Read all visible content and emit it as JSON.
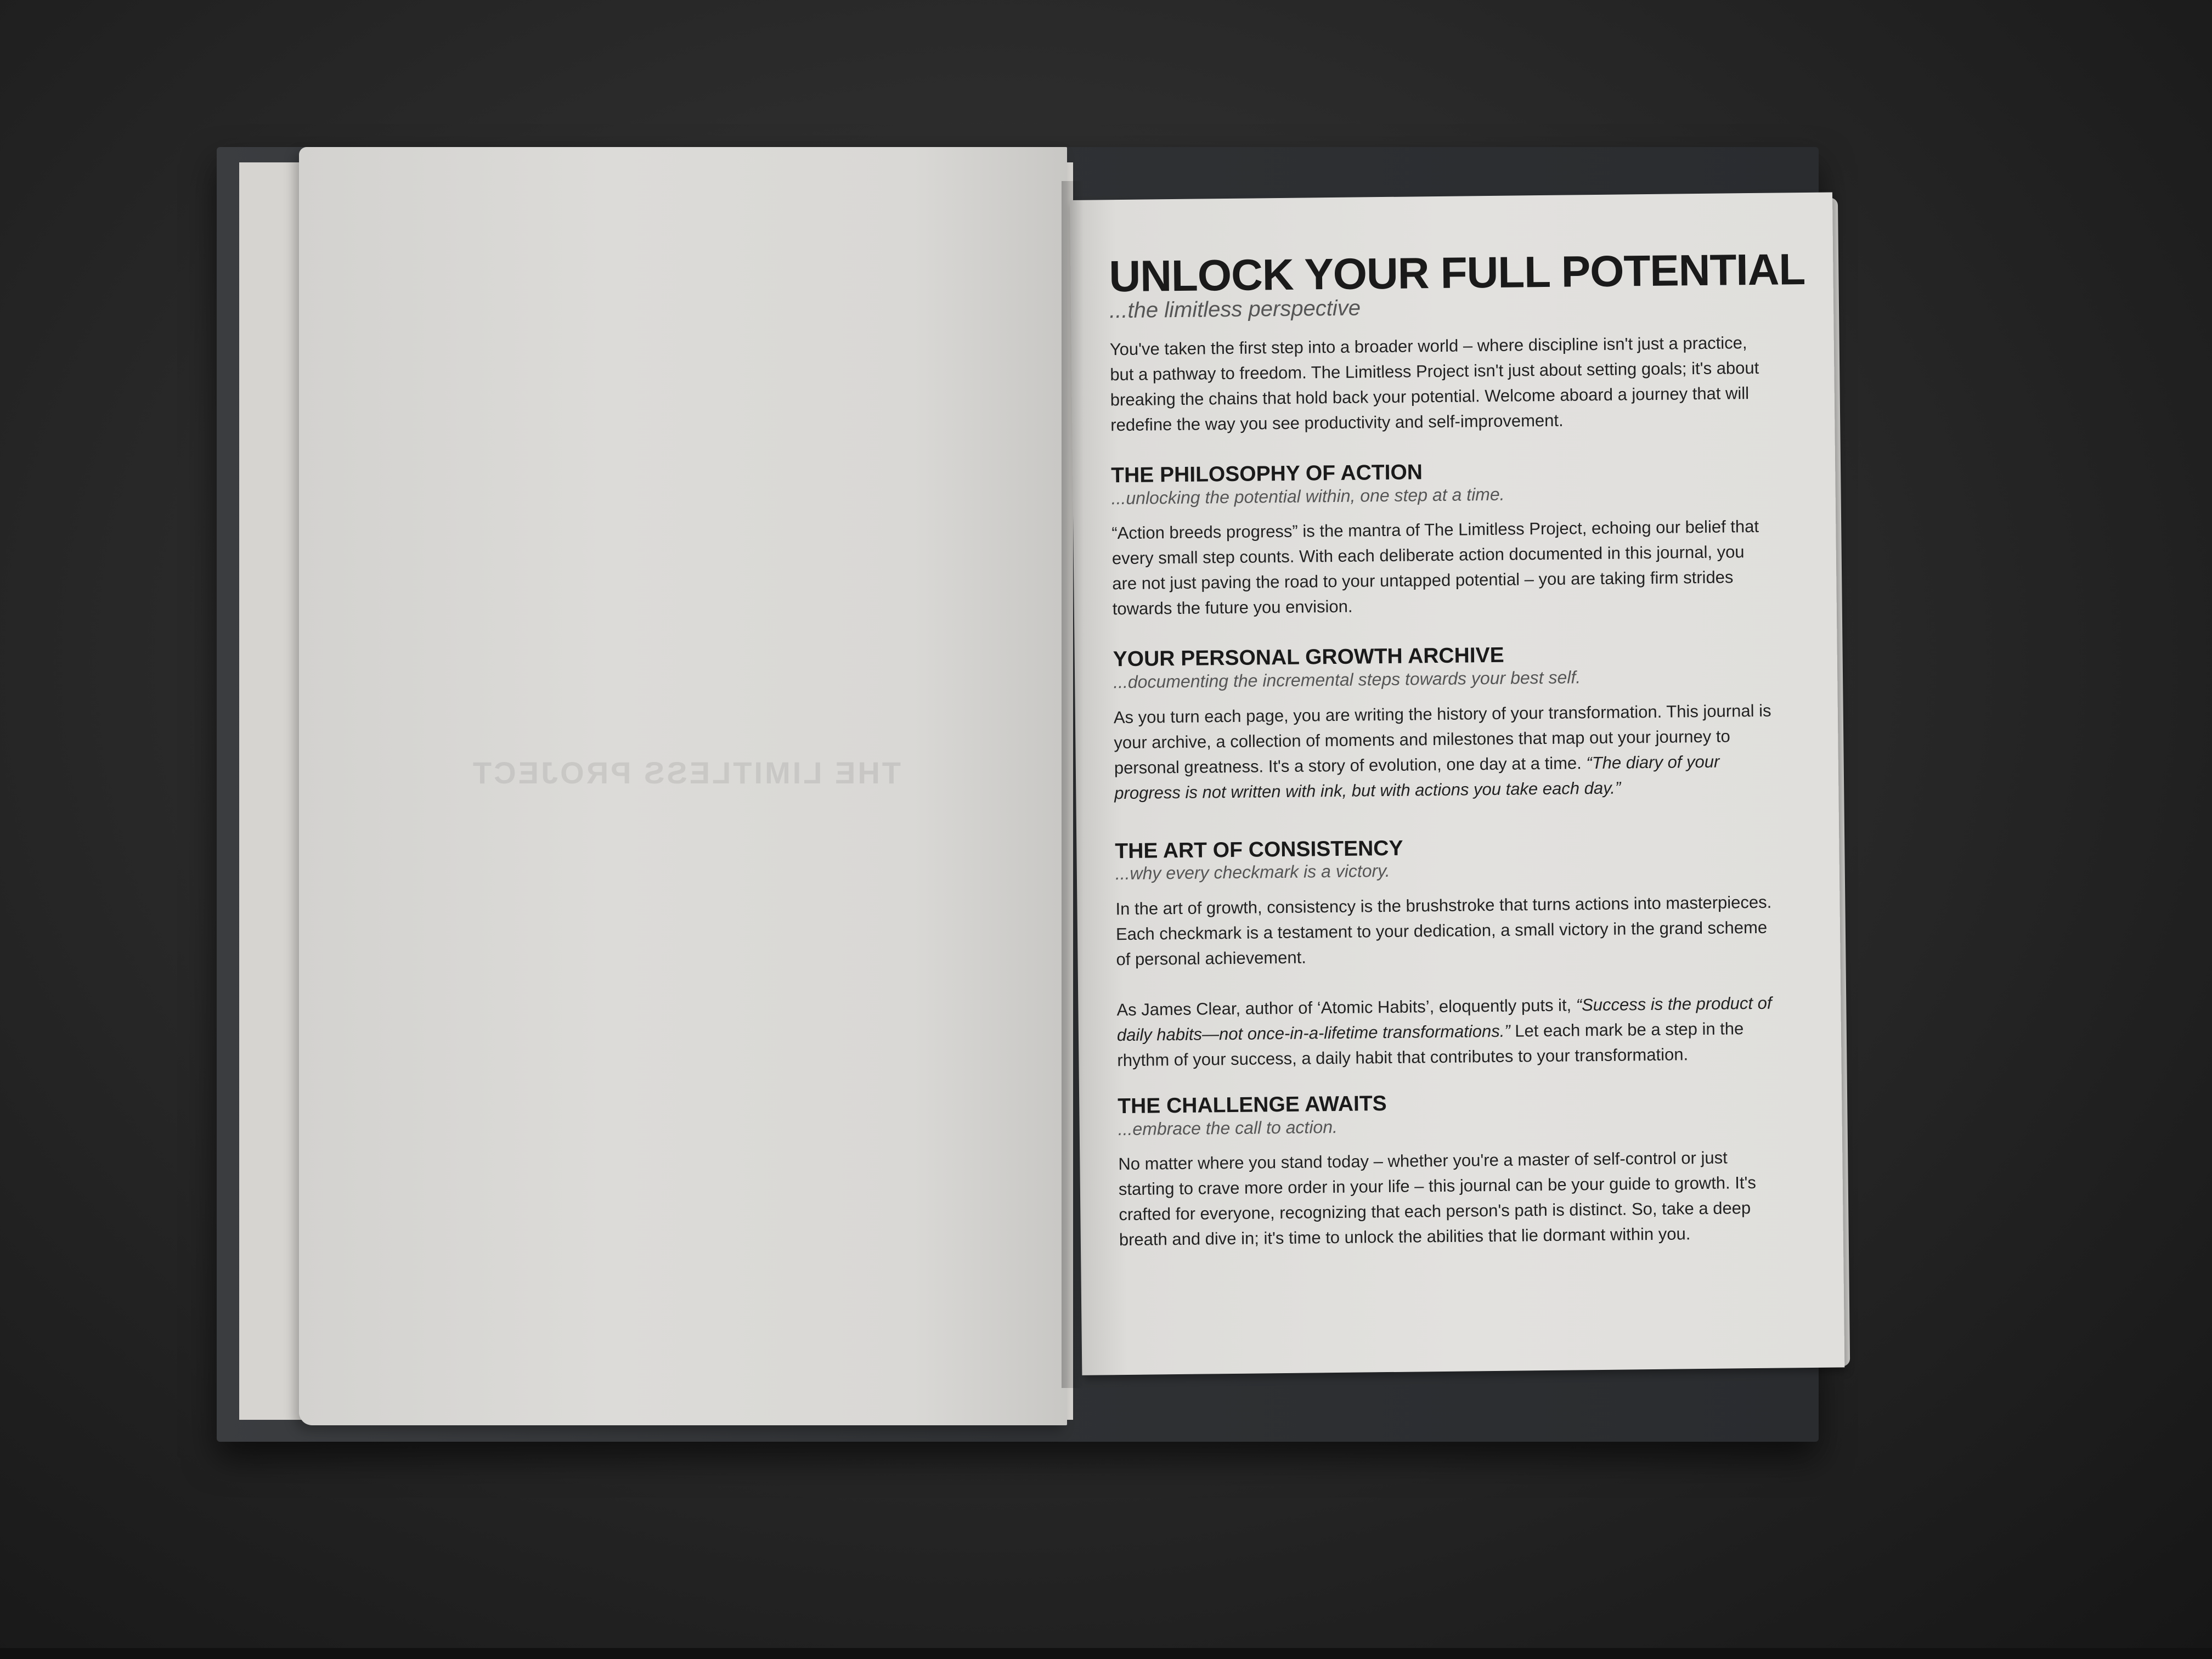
{
  "left_page": {
    "bleed_text": "THE LIMITLESS PROJECT"
  },
  "right_page": {
    "title": "UNLOCK YOUR FULL POTENTIAL",
    "subtitle": "...the limitless perspective",
    "intro": "You've taken the first step into a broader world – where discipline isn't just a practice, but a pathway to freedom. The Limitless Project isn't just about setting goals; it's about breaking the chains that hold back your potential. Welcome aboard a journey that will redefine the way you see productivity and self-improvement.",
    "sections": [
      {
        "heading": "THE PHILOSOPHY OF ACTION",
        "sub": "...unlocking the potential within, one step at a time.",
        "text": "“Action breeds progress” is the mantra of The Limitless Project, echoing our belief that every small step counts. With each deliberate action documented in this journal, you are not just paving the road to your untapped potential – you are taking firm strides towards the future you envision."
      },
      {
        "heading": "YOUR PERSONAL GROWTH ARCHIVE",
        "sub": "...documenting the incremental steps towards your best self.",
        "text": "As you turn each page, you are writing the history of your transformation. This journal is your archive, a collection of moments and milestones that map out your journey to personal greatness. It's a story of evolution, one day at a time.",
        "quote": "“The diary of your progress is not written with ink, but with actions you take each day.”"
      },
      {
        "heading": "THE ART OF CONSISTENCY",
        "sub": "...why every checkmark is a victory.",
        "text": "In the art of growth, consistency is the brushstroke that turns actions into masterpieces. Each checkmark is a testament to your dedication, a small victory in the grand scheme of personal achievement.",
        "text2_pre": "As James Clear, author of ‘Atomic Habits’, eloquently puts it,",
        "quote": "“Success is the product of daily habits—not once-in-a-lifetime transformations.”",
        "text2_post": "Let each mark be a step in the rhythm of your success, a daily habit that contributes to your transformation."
      },
      {
        "heading": "THE CHALLENGE AWAITS",
        "sub": "...embrace the call to action.",
        "text": "No matter where you stand today – whether you're a master of self-control or just starting to crave more order in your life – this journal can be your guide to growth. It's crafted for everyone, recognizing that each person's path is distinct. So, take a deep breath and dive in; it's time to unlock the abilities that lie dormant within you."
      }
    ]
  }
}
